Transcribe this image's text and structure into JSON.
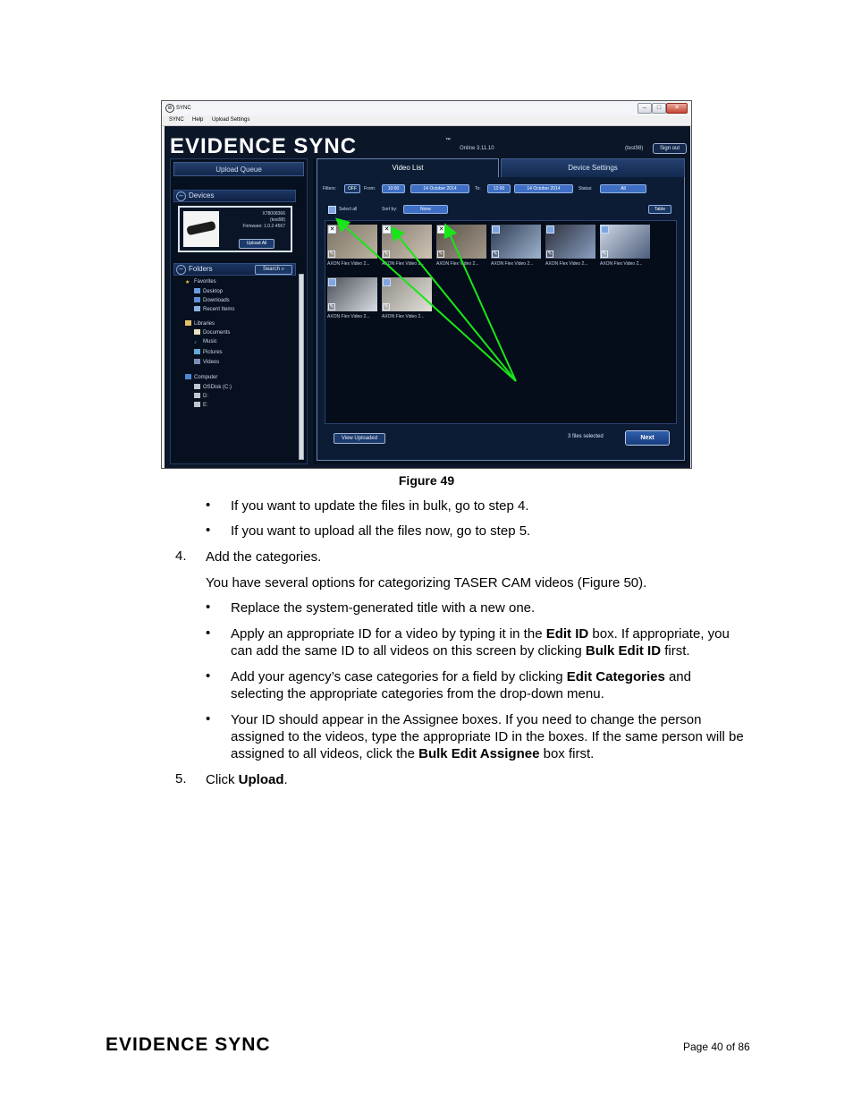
{
  "window": {
    "title": "SYNC",
    "menu": [
      "SYNC",
      "Help",
      "Upload Settings"
    ]
  },
  "app": {
    "brand": "EVIDENCE SYNC",
    "brand_mark": "™",
    "version": "Online 3.11.10",
    "user": "(test98)",
    "sign_out": "Sign out",
    "upload_queue": "Upload Queue",
    "devices_label": "Devices",
    "device": {
      "serial": "X78008366",
      "owner": "(test98)",
      "firmware": "Firmware: 1.0.2-4567",
      "upload_all": "Upload All"
    },
    "folders_label": "Folders",
    "search_label": "Search",
    "folder_tree": {
      "favorites": "Favorites",
      "desktop": "Desktop",
      "downloads": "Downloads",
      "recent": "Recent Items",
      "libraries": "Libraries",
      "documents": "Documents",
      "music": "Music",
      "pictures": "Pictures",
      "videos": "Videos",
      "computer": "Computer",
      "osdisk": "OSDisk (C:)",
      "d": "D:",
      "e": "E:"
    },
    "tabs": {
      "video_list": "Video List",
      "device_settings": "Device Settings"
    },
    "filters": {
      "label": "Filters:",
      "toggle": "OFF",
      "from_label": "From:",
      "from_time": "10:00",
      "from_date": "14 October 2014",
      "to_label": "To:",
      "to_time": "12:00",
      "to_date": "14 October 2014",
      "status_label": "Status:",
      "status_value": "All"
    },
    "select_all": "Select all",
    "sort_by_label": "Sort by:",
    "sort_by_value": "None",
    "table_btn": "Table",
    "videos": [
      {
        "name": "AXON Flex Video 2...",
        "checked": true
      },
      {
        "name": "AXON Flex Video 2...",
        "checked": true
      },
      {
        "name": "AXON Flex Video 2...",
        "checked": true
      },
      {
        "name": "AXON Flex Video 2...",
        "checked": false
      },
      {
        "name": "AXON Flex Video 2...",
        "checked": false
      },
      {
        "name": "AXON Flex Video 2...",
        "checked": false
      },
      {
        "name": "AXON Flex Video 2...",
        "checked": false
      },
      {
        "name": "AXON Flex Video 2...",
        "checked": false
      }
    ],
    "view_uploaded": "View Uploaded",
    "files_selected": "3 files selected",
    "next": "Next"
  },
  "caption": "Figure 49",
  "body": {
    "bullet1": "If you want to update the files in bulk, go to step 4.",
    "bullet2": "If you want to upload all the files now, go to step 5.",
    "step4_num": "4.",
    "step4": "Add the categories.",
    "step4_intro": "You have several options for categorizing TASER CAM videos (Figure 50).",
    "b3": "Replace the system-generated title with a new one.",
    "b4_a": "Apply an appropriate ID for a video by typing it in the ",
    "b4_bold1": "Edit ID",
    "b4_b": " box. If appropriate, you can add the same ID to all videos on this screen by clicking ",
    "b4_bold2": "Bulk Edit ID",
    "b4_c": " first.",
    "b5_a": "Add your agency’s case categories for a field by clicking ",
    "b5_bold": "Edit Categories",
    "b5_b": " and selecting the appropriate categories from the drop-down menu.",
    "b6_a": "Your ID should appear in the Assignee boxes. If you need to change the person assigned to the videos, type the appropriate ID in the boxes. If the same person will be assigned to all videos, click the ",
    "b6_bold": "Bulk Edit Assignee",
    "b6_b": " box first.",
    "step5_num": "5.",
    "step5_a": "Click ",
    "step5_bold": "Upload",
    "step5_b": "."
  },
  "footer": {
    "logo": "EVIDENCE SYNC",
    "page": "Page 40 of 86"
  },
  "colors": {
    "app_bg": "#0b1628",
    "accent_blue": "#3e6fc4",
    "annotation_arrow": "#19e619"
  }
}
